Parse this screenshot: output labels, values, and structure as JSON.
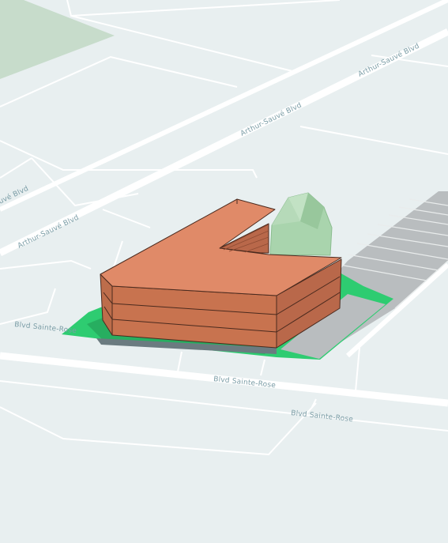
{
  "map": {
    "colors": {
      "background": "#e8eff0",
      "road": "#ffffff",
      "park": "#c7dccb",
      "label": "#7b9da6",
      "site_green": "#2ecc71",
      "site_green_dark": "#27ae60",
      "parking": "#b9bdbf",
      "building_top": "#e08a68",
      "building_side": "#c8734f",
      "building_outline": "#4a2a1e",
      "tree": "#a9d4ad"
    },
    "street_labels": {
      "arthur_sauve_1": "Arthur-Sauvé Blvd",
      "arthur_sauve_2": "Arthur-Sauvé Blvd",
      "arthur_sauve_3": "Arthur-Sauvé Blvd",
      "arthur_sauve_4": "uvé Blvd",
      "sainte_rose_1": "Blvd Sainte-Rose",
      "sainte_rose_2": "Blvd Sainte-Rose",
      "sainte_rose_3": "Blvd Sainte-Rose"
    }
  }
}
